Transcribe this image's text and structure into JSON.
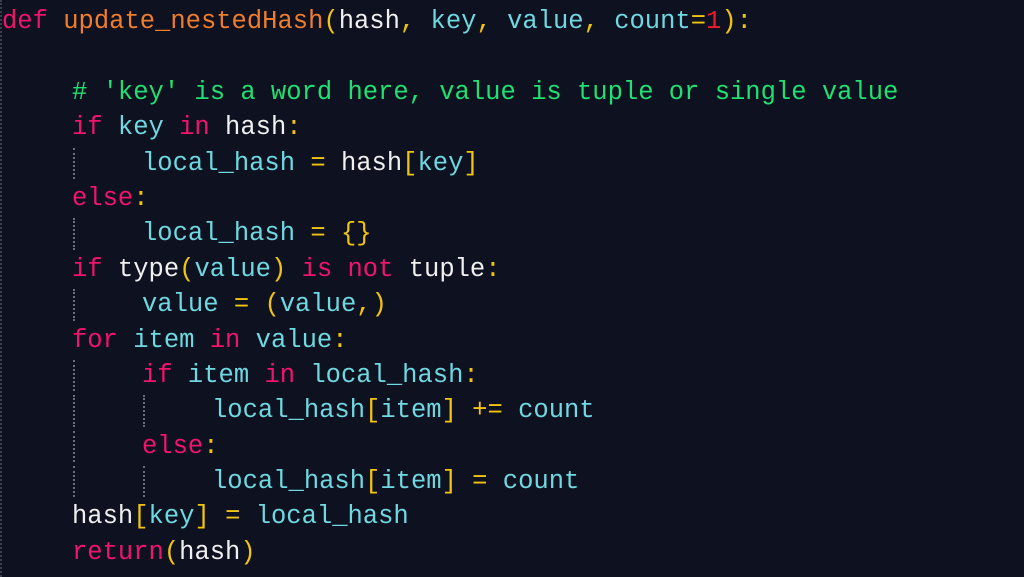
{
  "editor": {
    "language": "python",
    "colors": {
      "background": "#0e1120",
      "keyword": "#f0146a",
      "function_name": "#f07d2b",
      "parameter": "#6fd8e0",
      "operator": "#f1c40f",
      "number": "#ee1c2a",
      "comment": "#1fe070",
      "builtin": "#f0f0f0"
    },
    "lines": [
      {
        "indent": 0,
        "tokens": [
          {
            "t": "def",
            "c": "kw"
          },
          {
            "t": " ",
            "c": "wh"
          },
          {
            "t": "update_nestedHash",
            "c": "fn"
          },
          {
            "t": "(",
            "c": "op"
          },
          {
            "t": "hash",
            "c": "wh"
          },
          {
            "t": ", ",
            "c": "op"
          },
          {
            "t": "key",
            "c": "pm"
          },
          {
            "t": ", ",
            "c": "op"
          },
          {
            "t": "value",
            "c": "pm"
          },
          {
            "t": ", ",
            "c": "op"
          },
          {
            "t": "count",
            "c": "pm"
          },
          {
            "t": "=",
            "c": "op"
          },
          {
            "t": "1",
            "c": "num"
          },
          {
            "t": ")",
            "c": "op"
          },
          {
            "t": ":",
            "c": "op"
          }
        ]
      },
      {
        "indent": 0,
        "tokens": []
      },
      {
        "indent": 1,
        "tokens": [
          {
            "t": "# 'key' is a word here, value is tuple or single value",
            "c": "cm"
          }
        ]
      },
      {
        "indent": 1,
        "tokens": [
          {
            "t": "if",
            "c": "kw"
          },
          {
            "t": " key ",
            "c": "id"
          },
          {
            "t": "in",
            "c": "kw"
          },
          {
            "t": " hash",
            "c": "wh"
          },
          {
            "t": ":",
            "c": "op"
          }
        ]
      },
      {
        "indent": 2,
        "guides": [
          1
        ],
        "tokens": [
          {
            "t": "local_hash",
            "c": "id"
          },
          {
            "t": " = ",
            "c": "op"
          },
          {
            "t": "hash",
            "c": "wh"
          },
          {
            "t": "[",
            "c": "op"
          },
          {
            "t": "key",
            "c": "id"
          },
          {
            "t": "]",
            "c": "op"
          }
        ]
      },
      {
        "indent": 1,
        "tokens": [
          {
            "t": "else",
            "c": "kw"
          },
          {
            "t": ":",
            "c": "op"
          }
        ]
      },
      {
        "indent": 2,
        "guides": [
          1
        ],
        "tokens": [
          {
            "t": "local_hash",
            "c": "id"
          },
          {
            "t": " = ",
            "c": "op"
          },
          {
            "t": "{}",
            "c": "op"
          }
        ]
      },
      {
        "indent": 1,
        "tokens": [
          {
            "t": "if",
            "c": "kw"
          },
          {
            "t": " type",
            "c": "wh"
          },
          {
            "t": "(",
            "c": "op"
          },
          {
            "t": "value",
            "c": "id"
          },
          {
            "t": ")",
            "c": "op"
          },
          {
            "t": " ",
            "c": "wh"
          },
          {
            "t": "is",
            "c": "kw"
          },
          {
            "t": " ",
            "c": "wh"
          },
          {
            "t": "not",
            "c": "kw"
          },
          {
            "t": " tuple",
            "c": "wh"
          },
          {
            "t": ":",
            "c": "op"
          }
        ]
      },
      {
        "indent": 2,
        "guides": [
          1
        ],
        "tokens": [
          {
            "t": "value",
            "c": "id"
          },
          {
            "t": " = ",
            "c": "op"
          },
          {
            "t": "(",
            "c": "op"
          },
          {
            "t": "value",
            "c": "id"
          },
          {
            "t": ",)",
            "c": "op"
          }
        ]
      },
      {
        "indent": 1,
        "tokens": [
          {
            "t": "for",
            "c": "kw"
          },
          {
            "t": " item ",
            "c": "id"
          },
          {
            "t": "in",
            "c": "kw"
          },
          {
            "t": " value",
            "c": "id"
          },
          {
            "t": ":",
            "c": "op"
          }
        ]
      },
      {
        "indent": 2,
        "guides": [
          1
        ],
        "tokens": [
          {
            "t": "if",
            "c": "kw"
          },
          {
            "t": " item ",
            "c": "id"
          },
          {
            "t": "in",
            "c": "kw"
          },
          {
            "t": " local_hash",
            "c": "id"
          },
          {
            "t": ":",
            "c": "op"
          }
        ]
      },
      {
        "indent": 3,
        "guides": [
          1,
          2
        ],
        "tokens": [
          {
            "t": "local_hash",
            "c": "id"
          },
          {
            "t": "[",
            "c": "op"
          },
          {
            "t": "item",
            "c": "id"
          },
          {
            "t": "]",
            "c": "op"
          },
          {
            "t": " += ",
            "c": "op"
          },
          {
            "t": "count",
            "c": "id"
          }
        ]
      },
      {
        "indent": 2,
        "guides": [
          1
        ],
        "tokens": [
          {
            "t": "else",
            "c": "kw"
          },
          {
            "t": ":",
            "c": "op"
          }
        ]
      },
      {
        "indent": 3,
        "guides": [
          1,
          2
        ],
        "tokens": [
          {
            "t": "local_hash",
            "c": "id"
          },
          {
            "t": "[",
            "c": "op"
          },
          {
            "t": "item",
            "c": "id"
          },
          {
            "t": "]",
            "c": "op"
          },
          {
            "t": " = ",
            "c": "op"
          },
          {
            "t": "count",
            "c": "id"
          }
        ]
      },
      {
        "indent": 1,
        "tokens": [
          {
            "t": "hash",
            "c": "wh"
          },
          {
            "t": "[",
            "c": "op"
          },
          {
            "t": "key",
            "c": "id"
          },
          {
            "t": "]",
            "c": "op"
          },
          {
            "t": " = ",
            "c": "op"
          },
          {
            "t": "local_hash",
            "c": "id"
          }
        ]
      },
      {
        "indent": 1,
        "tokens": [
          {
            "t": "return",
            "c": "kw"
          },
          {
            "t": "(",
            "c": "op"
          },
          {
            "t": "hash",
            "c": "wh"
          },
          {
            "t": ")",
            "c": "op"
          }
        ]
      }
    ]
  }
}
